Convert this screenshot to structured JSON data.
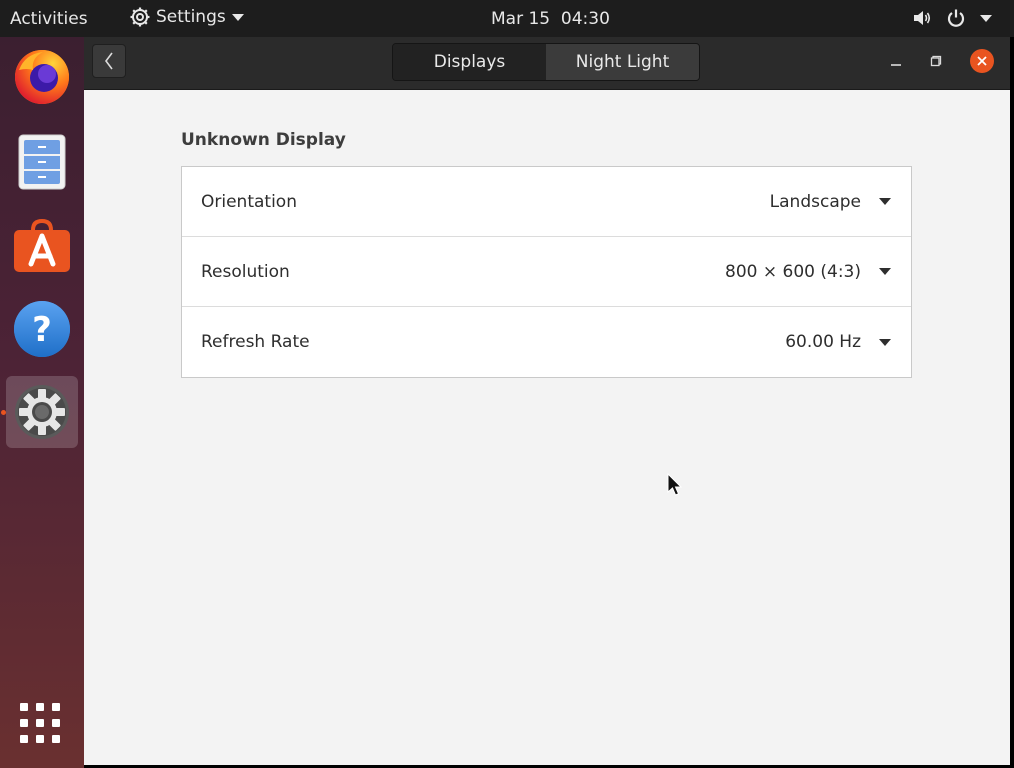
{
  "top_bar": {
    "activities": "Activities",
    "app_menu_label": "Settings",
    "clock": "Mar 15  04:30",
    "tray_icons": [
      "volume-icon",
      "power-icon",
      "menu-caret-icon"
    ]
  },
  "dock": {
    "items": [
      {
        "name": "firefox",
        "icon": "firefox-icon"
      },
      {
        "name": "files",
        "icon": "files-icon"
      },
      {
        "name": "software",
        "icon": "software-store-icon"
      },
      {
        "name": "help",
        "icon": "help-icon"
      },
      {
        "name": "settings",
        "icon": "settings-gear-icon",
        "active": true
      }
    ],
    "apps_icon": "show-applications-icon"
  },
  "window": {
    "tabs": [
      {
        "label": "Displays",
        "selected": true
      },
      {
        "label": "Night Light",
        "selected": false
      }
    ],
    "controls": [
      "minimize-icon",
      "maximize-icon",
      "close-icon"
    ],
    "display_name": "Unknown Display",
    "settings": [
      {
        "label": "Orientation",
        "value": "Landscape"
      },
      {
        "label": "Resolution",
        "value": "800 × 600 (4:3)"
      },
      {
        "label": "Refresh Rate",
        "value": "60.00 Hz"
      }
    ]
  },
  "colors": {
    "accent": "#e95420",
    "panel": "#1d1d1d",
    "headerbar": "#2b2b2b"
  }
}
